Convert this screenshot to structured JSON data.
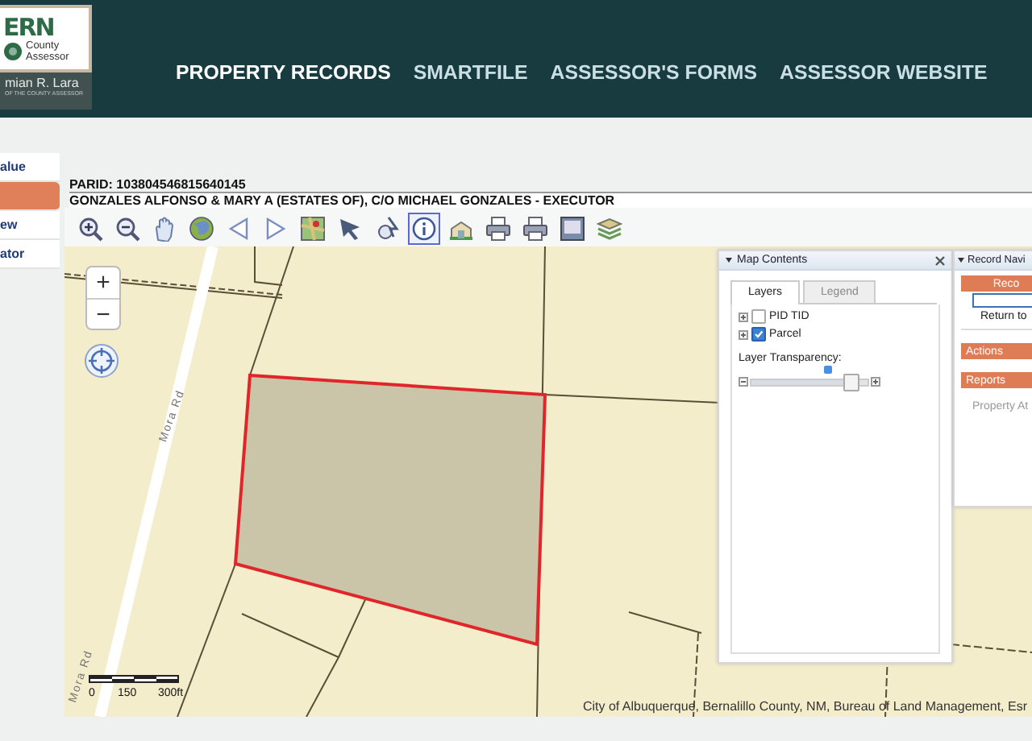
{
  "header": {
    "logo": {
      "wordmark": "ERN",
      "subtitle": [
        "County",
        "Assessor"
      ],
      "name": "mian R. Lara",
      "tagline": "OF THE COUNTY ASSESSOR"
    },
    "nav": [
      {
        "label": "PROPERTY RECORDS",
        "selected": true
      },
      {
        "label": "SMARTFILE",
        "selected": false
      },
      {
        "label": "ASSESSOR'S FORMS",
        "selected": false
      },
      {
        "label": "ASSESSOR WEBSITE",
        "selected": false
      }
    ]
  },
  "sidebar": {
    "items": [
      {
        "label": "alue",
        "selected": false
      },
      {
        "selected": true
      },
      {
        "label": "ew",
        "selected": false
      },
      {
        "label": "ator",
        "selected": false
      }
    ]
  },
  "record": {
    "parid": "PARID: 103804546815640145",
    "owner": "GONZALES ALFONSO & MARY A (ESTATES OF), C/O MICHAEL GONZALES - EXECUTOR"
  },
  "toolbar": [
    {
      "kind": "zoom_in",
      "selected": false
    },
    {
      "kind": "zoom_out",
      "selected": false
    },
    {
      "kind": "pan",
      "selected": false
    },
    {
      "kind": "globe",
      "selected": false
    },
    {
      "kind": "back",
      "selected": false
    },
    {
      "kind": "forward",
      "selected": false
    },
    {
      "kind": "map",
      "selected": false
    },
    {
      "kind": "select",
      "selected": false
    },
    {
      "kind": "locate",
      "selected": false
    },
    {
      "kind": "info",
      "selected": true
    },
    {
      "kind": "building",
      "selected": false
    },
    {
      "kind": "print",
      "selected": false
    },
    {
      "kind": "print",
      "selected": false
    },
    {
      "kind": "document",
      "selected": false
    },
    {
      "kind": "layers",
      "selected": false
    }
  ],
  "map": {
    "zoom_in": "+",
    "zoom_out": "−",
    "road_labels": [
      "Mora Rd",
      "Mora Rd"
    ],
    "scale_labels": [
      "0",
      "150",
      "300ft"
    ],
    "attribution": "City of Albuquerque, Bernalillo County, NM, Bureau of Land Management, Esr",
    "map_contents": {
      "title": "Map Contents",
      "tabs": [
        {
          "label": "Layers",
          "selected": true
        },
        {
          "label": "Legend",
          "selected": false
        }
      ],
      "layers": [
        {
          "name": "PID TID",
          "checked": false
        },
        {
          "name": "Parcel",
          "checked": true
        }
      ],
      "transparency_label": "Layer Transparency:",
      "transparency": {
        "level": 0.85
      }
    },
    "record_nav": {
      "title": "Record Navi",
      "header": "Reco",
      "return_label": "Return to",
      "sections": [
        "Actions",
        "Reports"
      ],
      "property_label": "Property At"
    }
  }
}
